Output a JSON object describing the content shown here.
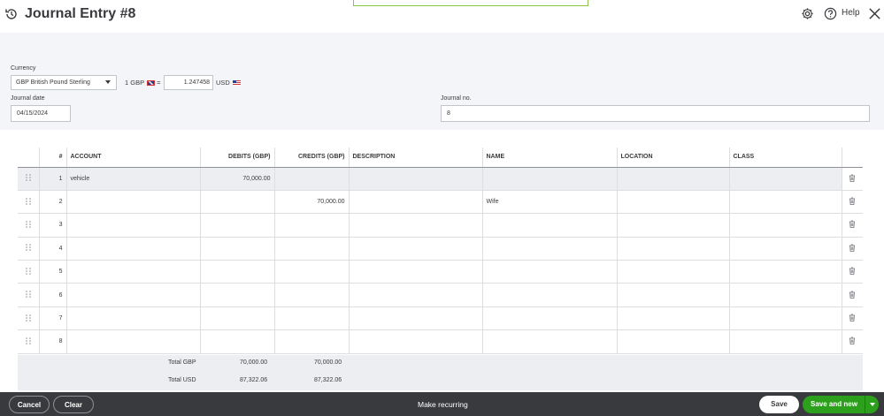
{
  "header": {
    "title": "Journal Entry #8",
    "help_label": "Help",
    "icons": [
      "history-icon",
      "gear-icon",
      "help-icon",
      "close-icon"
    ]
  },
  "form": {
    "currency_label": "Currency",
    "currency_value": "GBP British Pound Sterling",
    "rate_prefix": "1 GBP",
    "rate_equals": "=",
    "rate_value": "1.247458",
    "rate_suffix": "USD",
    "date_label": "Journal date",
    "date_value": "04/15/2024",
    "journal_no_label": "Journal no.",
    "journal_no_value": "8"
  },
  "table": {
    "headers": [
      "#",
      "ACCOUNT",
      "DEBITS (GBP)",
      "CREDITS (GBP)",
      "DESCRIPTION",
      "NAME",
      "LOCATION",
      "CLASS"
    ],
    "rows": [
      {
        "n": "1",
        "account": "vehicle",
        "debit": "70,000.00",
        "credit": "",
        "description": "",
        "name": "",
        "location": "",
        "class": ""
      },
      {
        "n": "2",
        "account": "",
        "debit": "",
        "credit": "70,000.00",
        "description": "",
        "name": "Wife",
        "location": "",
        "class": ""
      },
      {
        "n": "3",
        "account": "",
        "debit": "",
        "credit": "",
        "description": "",
        "name": "",
        "location": "",
        "class": ""
      },
      {
        "n": "4",
        "account": "",
        "debit": "",
        "credit": "",
        "description": "",
        "name": "",
        "location": "",
        "class": ""
      },
      {
        "n": "5",
        "account": "",
        "debit": "",
        "credit": "",
        "description": "",
        "name": "",
        "location": "",
        "class": ""
      },
      {
        "n": "6",
        "account": "",
        "debit": "",
        "credit": "",
        "description": "",
        "name": "",
        "location": "",
        "class": ""
      },
      {
        "n": "7",
        "account": "",
        "debit": "",
        "credit": "",
        "description": "",
        "name": "",
        "location": "",
        "class": ""
      },
      {
        "n": "8",
        "account": "",
        "debit": "",
        "credit": "",
        "description": "",
        "name": "",
        "location": "",
        "class": ""
      }
    ]
  },
  "totals": {
    "gbp_label": "Total GBP",
    "gbp_debit": "70,000.00",
    "gbp_credit": "70,000.00",
    "usd_label": "Total USD",
    "usd_debit": "87,322.06",
    "usd_credit": "87,322.06"
  },
  "footer": {
    "cancel": "Cancel",
    "clear": "Clear",
    "make_recurring": "Make recurring",
    "save": "Save",
    "save_and_new": "Save and new"
  },
  "colors": {
    "accent_green": "#2ca01c",
    "footer_bg": "#393a3d",
    "form_bg": "#f4f5f8"
  }
}
